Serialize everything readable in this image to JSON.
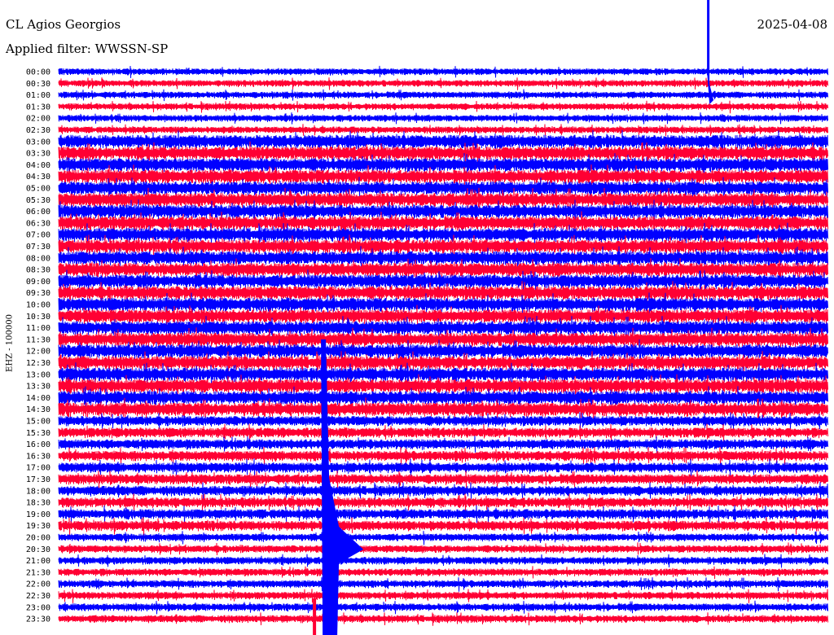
{
  "header": {
    "station": "CL Agios Georgios",
    "date": "2025-04-08",
    "filter": "Applied filter: WWSSN-SP"
  },
  "chart_data": {
    "type": "line",
    "title": "CL Agios Georgios",
    "ylabel": "EHZ - 100000",
    "row_labels": [
      "00:00",
      "00:30",
      "01:00",
      "01:30",
      "02:00",
      "02:30",
      "03:00",
      "03:30",
      "04:00",
      "04:30",
      "05:00",
      "05:30",
      "06:00",
      "06:30",
      "07:00",
      "07:30",
      "08:00",
      "08:30",
      "09:00",
      "09:30",
      "10:00",
      "10:30",
      "11:00",
      "11:30",
      "12:00",
      "12:30",
      "13:00",
      "13:30",
      "14:00",
      "14:30",
      "15:00",
      "15:30",
      "16:00",
      "16:30",
      "17:00",
      "17:30",
      "18:00",
      "18:30",
      "19:00",
      "19:30",
      "20:00",
      "20:30",
      "21:00",
      "21:30",
      "22:00",
      "22:30",
      "23:00",
      "23:30"
    ],
    "x_range_minutes": [
      0,
      30
    ],
    "trace_colors": [
      "#0000ff",
      "#ff0033"
    ],
    "events": [
      {
        "row": "00:00",
        "minute": 25.3,
        "note": "local spike"
      },
      {
        "row": "11:30",
        "minute": 10.3,
        "note": "large earthquake onset"
      }
    ],
    "grid": false,
    "legend": "none"
  }
}
